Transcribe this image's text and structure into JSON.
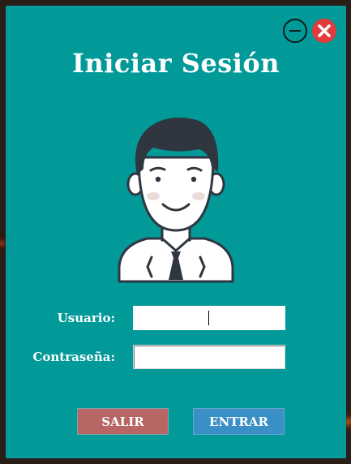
{
  "window": {
    "title": "Iniciar Sesión",
    "background_color": "#029a99"
  },
  "controls": {
    "minimize_icon": "minus-circle-icon",
    "close_icon": "close-circle-icon",
    "close_color": "#e23b3b"
  },
  "avatar": {
    "icon": "user-avatar-icon"
  },
  "form": {
    "username_label": "Usuario:",
    "username_value": "",
    "password_label": "Contraseña:",
    "password_value": ""
  },
  "buttons": {
    "exit_label": "SALIR",
    "exit_color": "#b86565",
    "enter_label": "ENTRAR",
    "enter_color": "#3b8fc7"
  }
}
